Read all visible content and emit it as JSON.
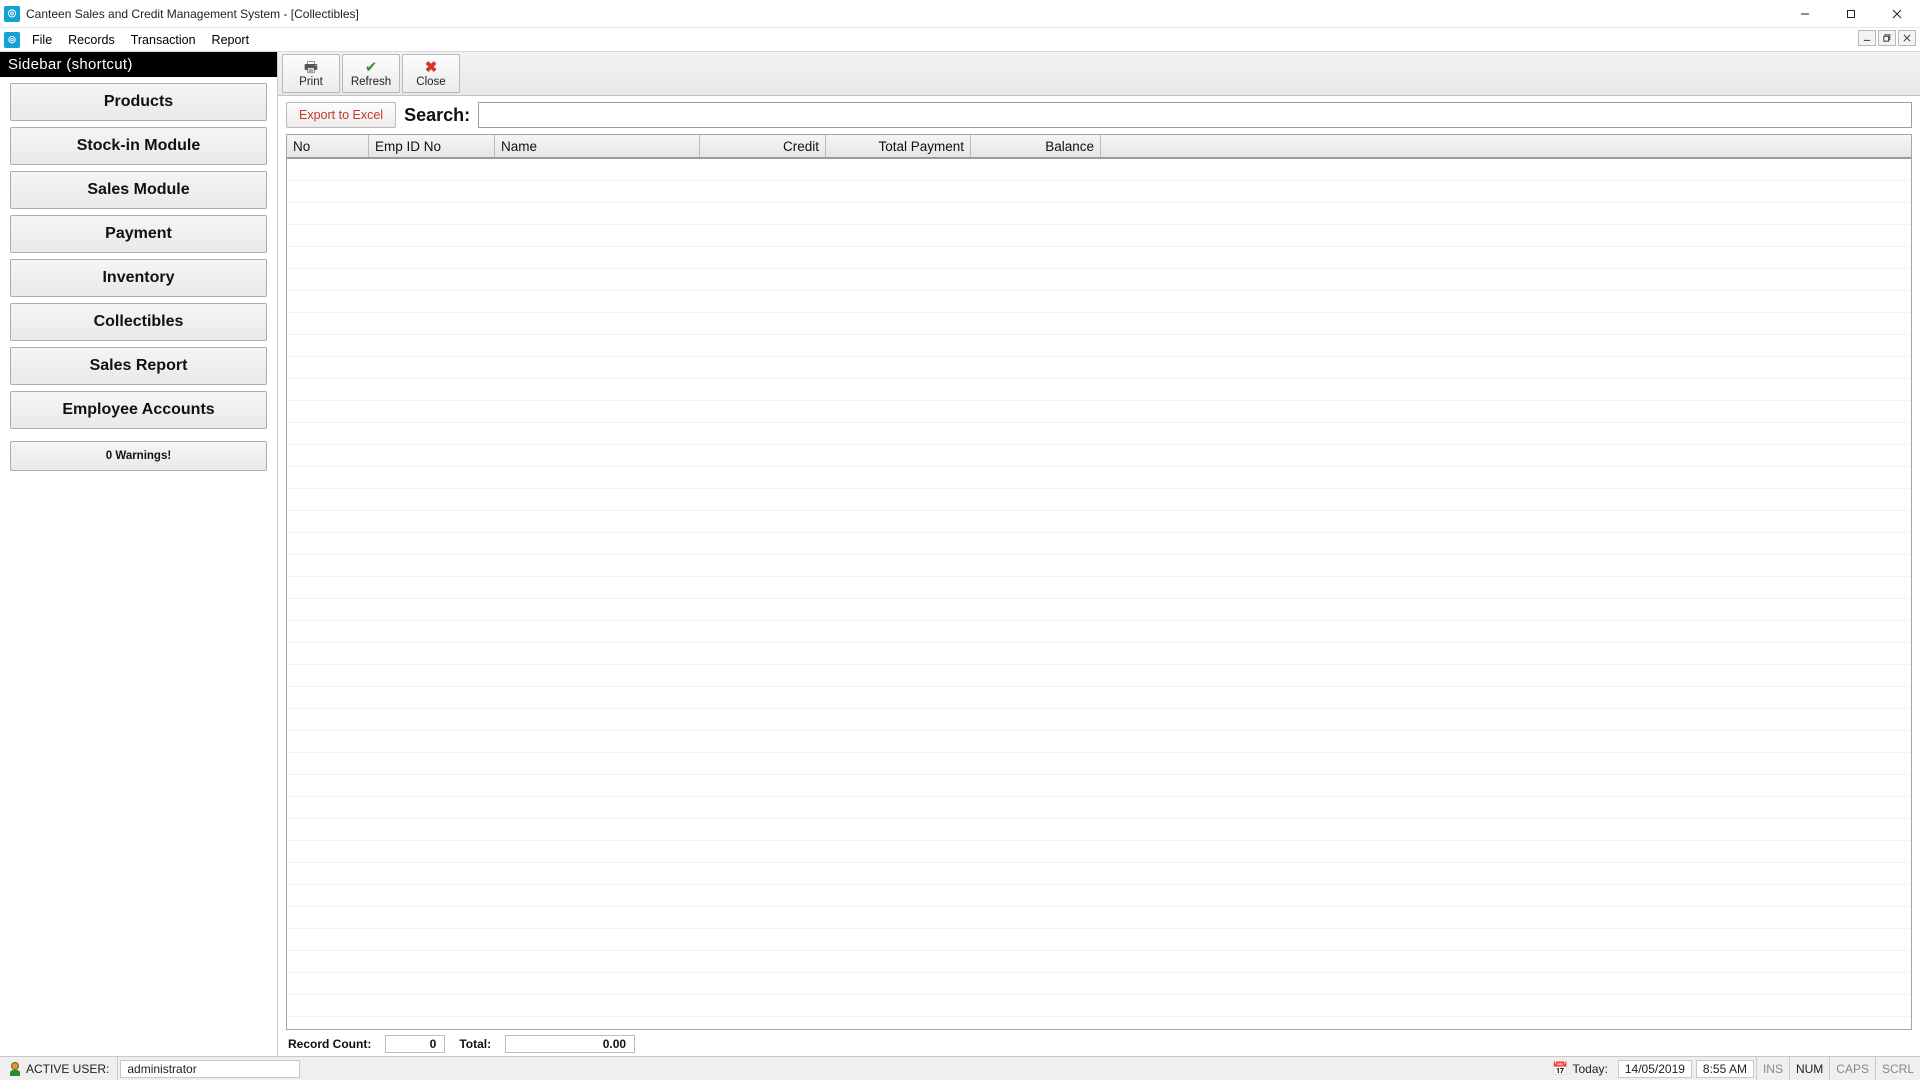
{
  "window": {
    "title": "Canteen Sales and Credit Management System - [Collectibles]"
  },
  "menu": {
    "items": [
      "File",
      "Records",
      "Transaction",
      "Report"
    ]
  },
  "sidebar": {
    "header": "Sidebar (shortcut)",
    "buttons": [
      "Products",
      "Stock-in Module",
      "Sales Module",
      "Payment",
      "Inventory",
      "Collectibles",
      "Sales Report",
      "Employee Accounts"
    ],
    "warnings": "0 Warnings!"
  },
  "toolbar": {
    "print": "Print",
    "refresh": "Refresh",
    "close": "Close"
  },
  "searchrow": {
    "export": "Export to Excel",
    "label": "Search:",
    "value": ""
  },
  "grid": {
    "columns": {
      "no": "No",
      "emp": "Emp ID No",
      "name": "Name",
      "credit": "Credit",
      "total": "Total Payment",
      "balance": "Balance"
    }
  },
  "footer": {
    "record_label": "Record Count:",
    "record_value": "0",
    "total_label": "Total:",
    "total_value": "0.00"
  },
  "status": {
    "active_user_label": "ACTIVE USER:",
    "active_user_value": "administrator",
    "today_label": "Today:",
    "date": "14/05/2019",
    "time": "8:55 AM",
    "ins": "INS",
    "num": "NUM",
    "caps": "CAPS",
    "scrl": "SCRL"
  }
}
